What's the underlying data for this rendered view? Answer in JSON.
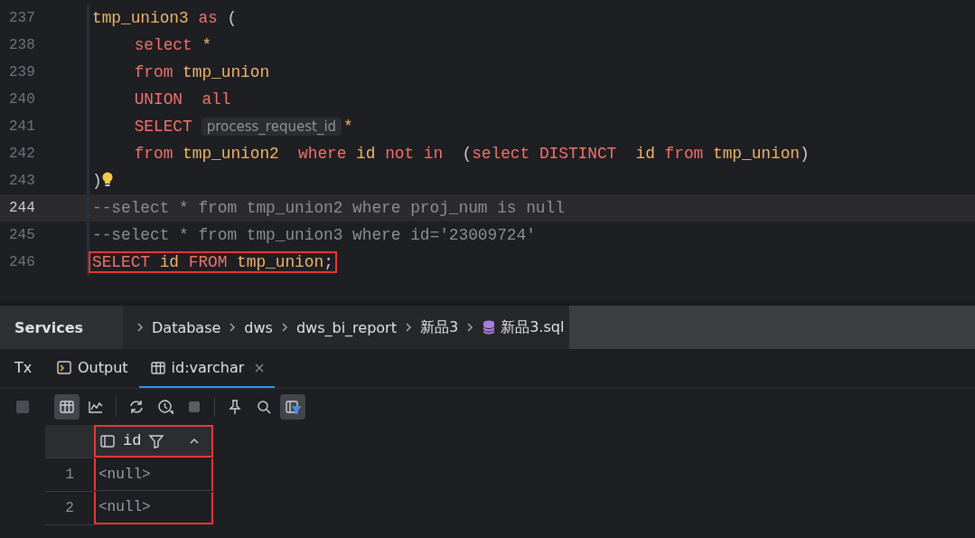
{
  "editor": {
    "lines": [
      {
        "number": "237",
        "current": false,
        "highlighted": false,
        "bulb": false,
        "indent": false,
        "tokens": [
          {
            "kind": "ident",
            "text": "tmp_union3 "
          },
          {
            "kind": "keyword",
            "text": "as"
          },
          {
            "kind": "plain",
            "text": " ("
          }
        ]
      },
      {
        "number": "238",
        "current": false,
        "highlighted": false,
        "bulb": false,
        "indent": true,
        "tokens": [
          {
            "kind": "keyword",
            "text": "select"
          },
          {
            "kind": "ident",
            "text": " *"
          }
        ]
      },
      {
        "number": "239",
        "current": false,
        "highlighted": false,
        "bulb": false,
        "indent": true,
        "tokens": [
          {
            "kind": "keyword",
            "text": "from"
          },
          {
            "kind": "ident",
            "text": " tmp_union"
          }
        ]
      },
      {
        "number": "240",
        "current": false,
        "highlighted": false,
        "bulb": false,
        "indent": true,
        "tokens": [
          {
            "kind": "keyword",
            "text": "UNION  all"
          }
        ]
      },
      {
        "number": "241",
        "current": false,
        "highlighted": false,
        "bulb": false,
        "indent": true,
        "tokens": [
          {
            "kind": "keyword",
            "text": "SELECT"
          },
          {
            "kind": "hint",
            "text": "process_request_id"
          },
          {
            "kind": "ident",
            "text": "*"
          }
        ]
      },
      {
        "number": "242",
        "current": false,
        "highlighted": false,
        "bulb": false,
        "indent": true,
        "tokens": [
          {
            "kind": "keyword",
            "text": "from"
          },
          {
            "kind": "ident",
            "text": " tmp_union2  "
          },
          {
            "kind": "keyword",
            "text": "where"
          },
          {
            "kind": "ident",
            "text": " id "
          },
          {
            "kind": "keyword",
            "text": "not in"
          },
          {
            "kind": "plain",
            "text": "  ("
          },
          {
            "kind": "keyword",
            "text": "select DISTINCT"
          },
          {
            "kind": "ident",
            "text": "  id "
          },
          {
            "kind": "keyword",
            "text": "from"
          },
          {
            "kind": "ident",
            "text": " tmp_union"
          },
          {
            "kind": "plain",
            "text": ")"
          }
        ]
      },
      {
        "number": "243",
        "current": false,
        "highlighted": false,
        "bulb": true,
        "indent": false,
        "tokens": [
          {
            "kind": "plain",
            "text": ")"
          }
        ]
      },
      {
        "number": "244",
        "current": true,
        "highlighted": false,
        "bulb": false,
        "indent": false,
        "tokens": [
          {
            "kind": "comment",
            "text": "--select * from tmp_union2 where proj_num is null"
          }
        ]
      },
      {
        "number": "245",
        "current": false,
        "highlighted": false,
        "bulb": false,
        "indent": false,
        "tokens": [
          {
            "kind": "comment",
            "text": "--select * from tmp_union3 where id='23009724'"
          }
        ]
      },
      {
        "number": "246",
        "current": false,
        "highlighted": true,
        "bulb": false,
        "indent": false,
        "tokens": [
          {
            "kind": "keyword",
            "text": "SELECT"
          },
          {
            "kind": "ident",
            "text": " id "
          },
          {
            "kind": "keyword",
            "text": "FROM"
          },
          {
            "kind": "ident",
            "text": " tmp_union"
          },
          {
            "kind": "plain",
            "text": ";"
          }
        ]
      }
    ]
  },
  "services": {
    "title": "Services",
    "breadcrumb": [
      {
        "text": "Database",
        "kind": "folder"
      },
      {
        "text": "dws",
        "kind": "folder"
      },
      {
        "text": "dws_bi_report",
        "kind": "folder"
      },
      {
        "text": "新品3",
        "kind": "folder"
      },
      {
        "text": "新品3.sql",
        "kind": "database"
      }
    ]
  },
  "tabs": [
    {
      "label": "Tx",
      "kind": "tx",
      "selected": false,
      "closable": false
    },
    {
      "label": "Output",
      "kind": "output",
      "selected": false,
      "closable": false
    },
    {
      "label": "id:varchar",
      "kind": "table",
      "selected": true,
      "closable": true
    }
  ],
  "toolbar": [
    {
      "kind": "table",
      "selected": true
    },
    {
      "kind": "chart",
      "selected": false
    },
    {
      "kind": "sep"
    },
    {
      "kind": "refresh",
      "selected": false
    },
    {
      "kind": "clock",
      "selected": false
    },
    {
      "kind": "stop",
      "selected": false
    },
    {
      "kind": "sep"
    },
    {
      "kind": "pin",
      "selected": false
    },
    {
      "kind": "search",
      "selected": false
    },
    {
      "kind": "filter",
      "selected": true
    }
  ],
  "grid": {
    "column": {
      "name": "id",
      "highlighted": true
    },
    "rows": [
      {
        "number": "1",
        "value": "<null>"
      },
      {
        "number": "2",
        "value": "<null>"
      }
    ]
  }
}
